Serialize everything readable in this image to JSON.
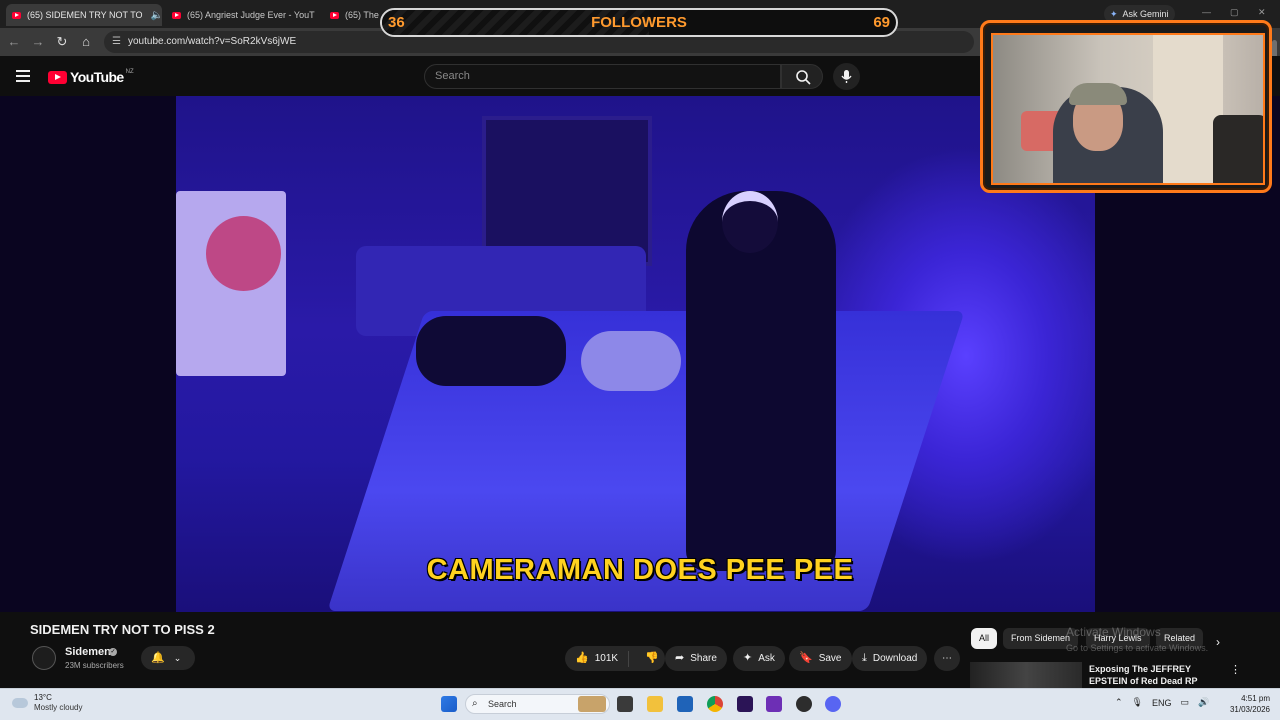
{
  "browser": {
    "tabs": [
      {
        "title": "(65) SIDEMEN TRY NOT TO",
        "active": true
      },
      {
        "title": "(65) Angriest Judge Ever - YouT",
        "active": false
      },
      {
        "title": "(65) The",
        "active": false
      }
    ],
    "url": "youtube.com/watch?v=SoR2kVs6jWE",
    "gemini_label": "Ask Gemini"
  },
  "youtube": {
    "logo_text": "YouTube",
    "country_code": "NZ",
    "search_placeholder": "Search"
  },
  "video": {
    "caption": "CAMERAMAN DOES PEE PEE"
  },
  "overlay": {
    "followers_label": "FOLLOWERS",
    "followers_current": "36",
    "followers_goal": "69",
    "progress": 0.52
  },
  "info": {
    "title": "SIDEMEN TRY NOT TO PISS 2",
    "channel_name": "Sidemen",
    "subscribers": "23M subscribers",
    "likes": "101K",
    "share": "Share",
    "ask": "Ask",
    "save": "Save",
    "download": "Download"
  },
  "related": {
    "chips": [
      "All",
      "From Sidemen",
      "Harry Lewis",
      "Related"
    ],
    "first_title": "Exposing The JEFFREY EPSTEIN of Red Dead RP"
  },
  "watermark": {
    "line1": "Activate Windows",
    "line2": "Go to Settings to activate Windows."
  },
  "taskbar": {
    "temp": "13°C",
    "weather": "Mostly cloudy",
    "search": "Search",
    "lang": "ENG",
    "time": "4:51 pm",
    "date": "31/03/2026"
  },
  "colors": {
    "youtube_red": "#ff0033",
    "overlay_orange": "#ff9a2e",
    "caption_yellow": "#ffd21f",
    "webcam_border": "#ff7a1a"
  }
}
